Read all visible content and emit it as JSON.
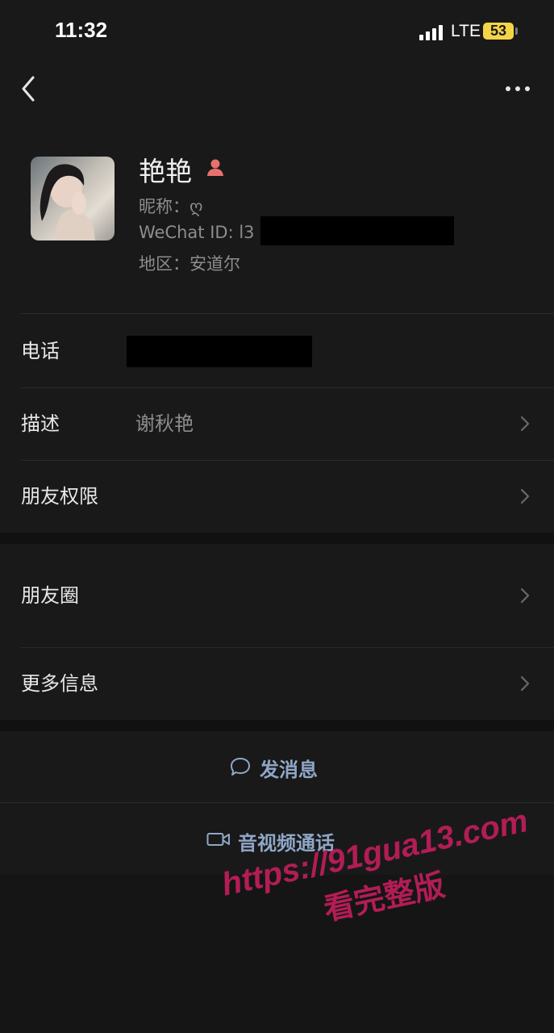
{
  "status_bar": {
    "time": "11:32",
    "network": "LTE",
    "battery": "53"
  },
  "profile": {
    "name": "艳艳",
    "nickname": "昵称：ღ",
    "wechat_id": "WeChat ID: l3",
    "region": "地区：安道尔"
  },
  "rows": {
    "phone": "电话",
    "description_label": "描述",
    "description_value": "谢秋艳",
    "permissions": "朋友权限",
    "moments": "朋友圈",
    "more_info": "更多信息"
  },
  "actions": {
    "message": "发消息",
    "call": "音视频通话"
  },
  "watermark": {
    "url": "https://91gua13.com",
    "cta": "看完整版"
  },
  "colors": {
    "background": "#191919",
    "link_blue": "#8fa6c7",
    "watermark": "#b21d55",
    "battery": "#f5d547"
  }
}
